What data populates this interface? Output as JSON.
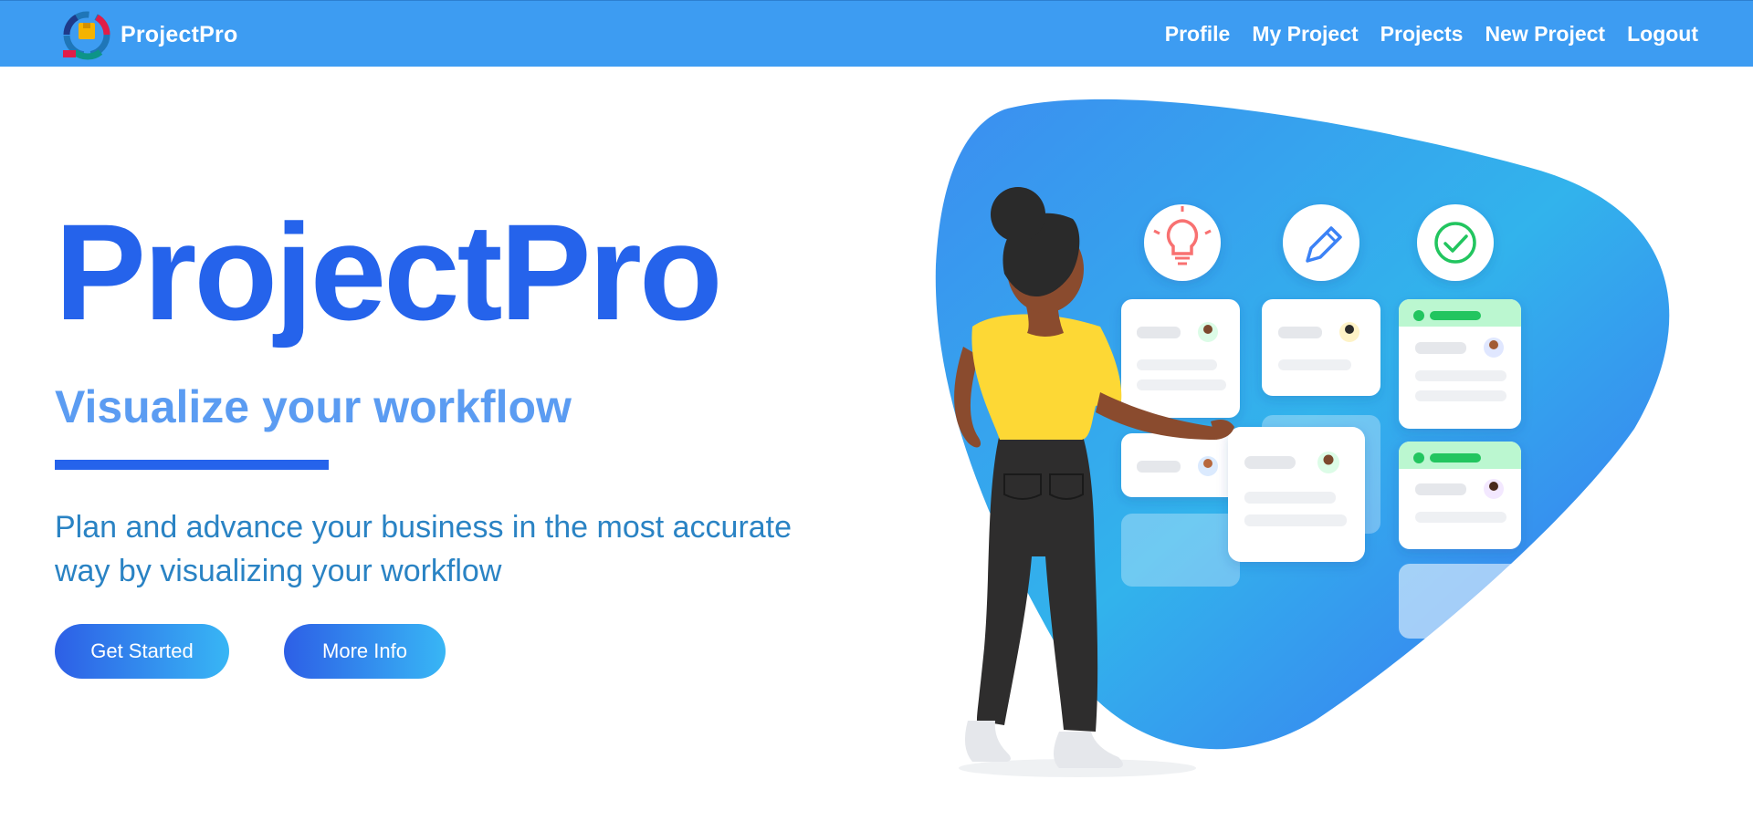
{
  "navbar": {
    "brand": "ProjectPro",
    "links": [
      "Profile",
      "My Project",
      "Projects",
      "New Project",
      "Logout"
    ]
  },
  "hero": {
    "title": "ProjectPro",
    "subtitle": "Visualize your workflow",
    "description": "Plan and advance your business in the most accurate way by visualizing your workflow",
    "primary_button": "Get Started",
    "secondary_button": "More Info"
  },
  "colors": {
    "navbar": "#3d9cf2",
    "title": "#2563eb",
    "subtitle": "#5b9cf2",
    "description": "#2a83c4",
    "button_gradient_start": "#2d5fe6",
    "button_gradient_end": "#38b6f5"
  },
  "illustration": {
    "icons": [
      "lightbulb-icon",
      "pencil-icon",
      "check-circle-icon"
    ]
  }
}
